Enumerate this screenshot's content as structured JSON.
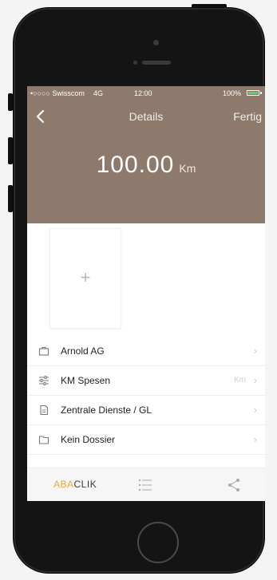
{
  "status_bar": {
    "carrier": "•○○○○ Swisscom",
    "network": "4G",
    "time": "12:00",
    "battery": "100%",
    "battery_level": 1.0
  },
  "nav": {
    "back_icon": "chevron-left-icon",
    "title": "Details",
    "done_label": "Fertig"
  },
  "summary": {
    "amount": "100.00",
    "unit": "Km"
  },
  "attachment": {
    "add_label": "+"
  },
  "list": [
    {
      "icon": "briefcase-icon",
      "label": "Arnold AG",
      "value": ""
    },
    {
      "icon": "sliders-icon",
      "label": "KM Spesen",
      "value": "Km"
    },
    {
      "icon": "document-icon",
      "label": "Zentrale Dienste / GL",
      "value": ""
    },
    {
      "icon": "folder-icon",
      "label": "Kein Dossier",
      "value": ""
    }
  ],
  "tabbar": {
    "brand_part1": "ABA",
    "brand_part2": "CLIK",
    "list_icon": "list-icon",
    "share_icon": "share-icon"
  },
  "colors": {
    "header_bg": "#8d7a6d",
    "brand_accent": "#f0a33a",
    "battery_green": "#4cd964"
  }
}
